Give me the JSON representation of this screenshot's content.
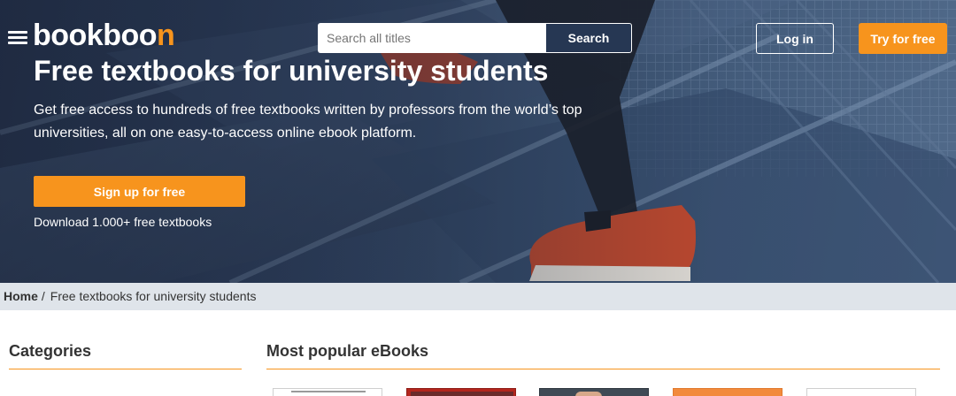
{
  "header": {
    "logo_main": "bookboo",
    "logo_accent": "n",
    "search_placeholder": "Search all titles",
    "search_label": "Search",
    "login_label": "Log in",
    "try_label": "Try for free"
  },
  "hero": {
    "title": "Free textbooks for university students",
    "subtitle": "Get free access to hundreds of free textbooks written by professors from the world’s top universities, all on one easy-to-access online ebook platform.",
    "signup_label": "Sign up for free",
    "download_text": "Download 1.000+ free textbooks"
  },
  "breadcrumb": {
    "home": "Home",
    "separator": "/",
    "current": "Free textbooks for university students"
  },
  "sections": {
    "categories": "Categories",
    "popular": "Most popular eBooks"
  },
  "colors": {
    "accent": "#f7941d",
    "hero_overlay": "#263753",
    "breadcrumb_bg": "#dfe4ea"
  },
  "icons": {
    "menu": "hamburger-menu-icon"
  }
}
